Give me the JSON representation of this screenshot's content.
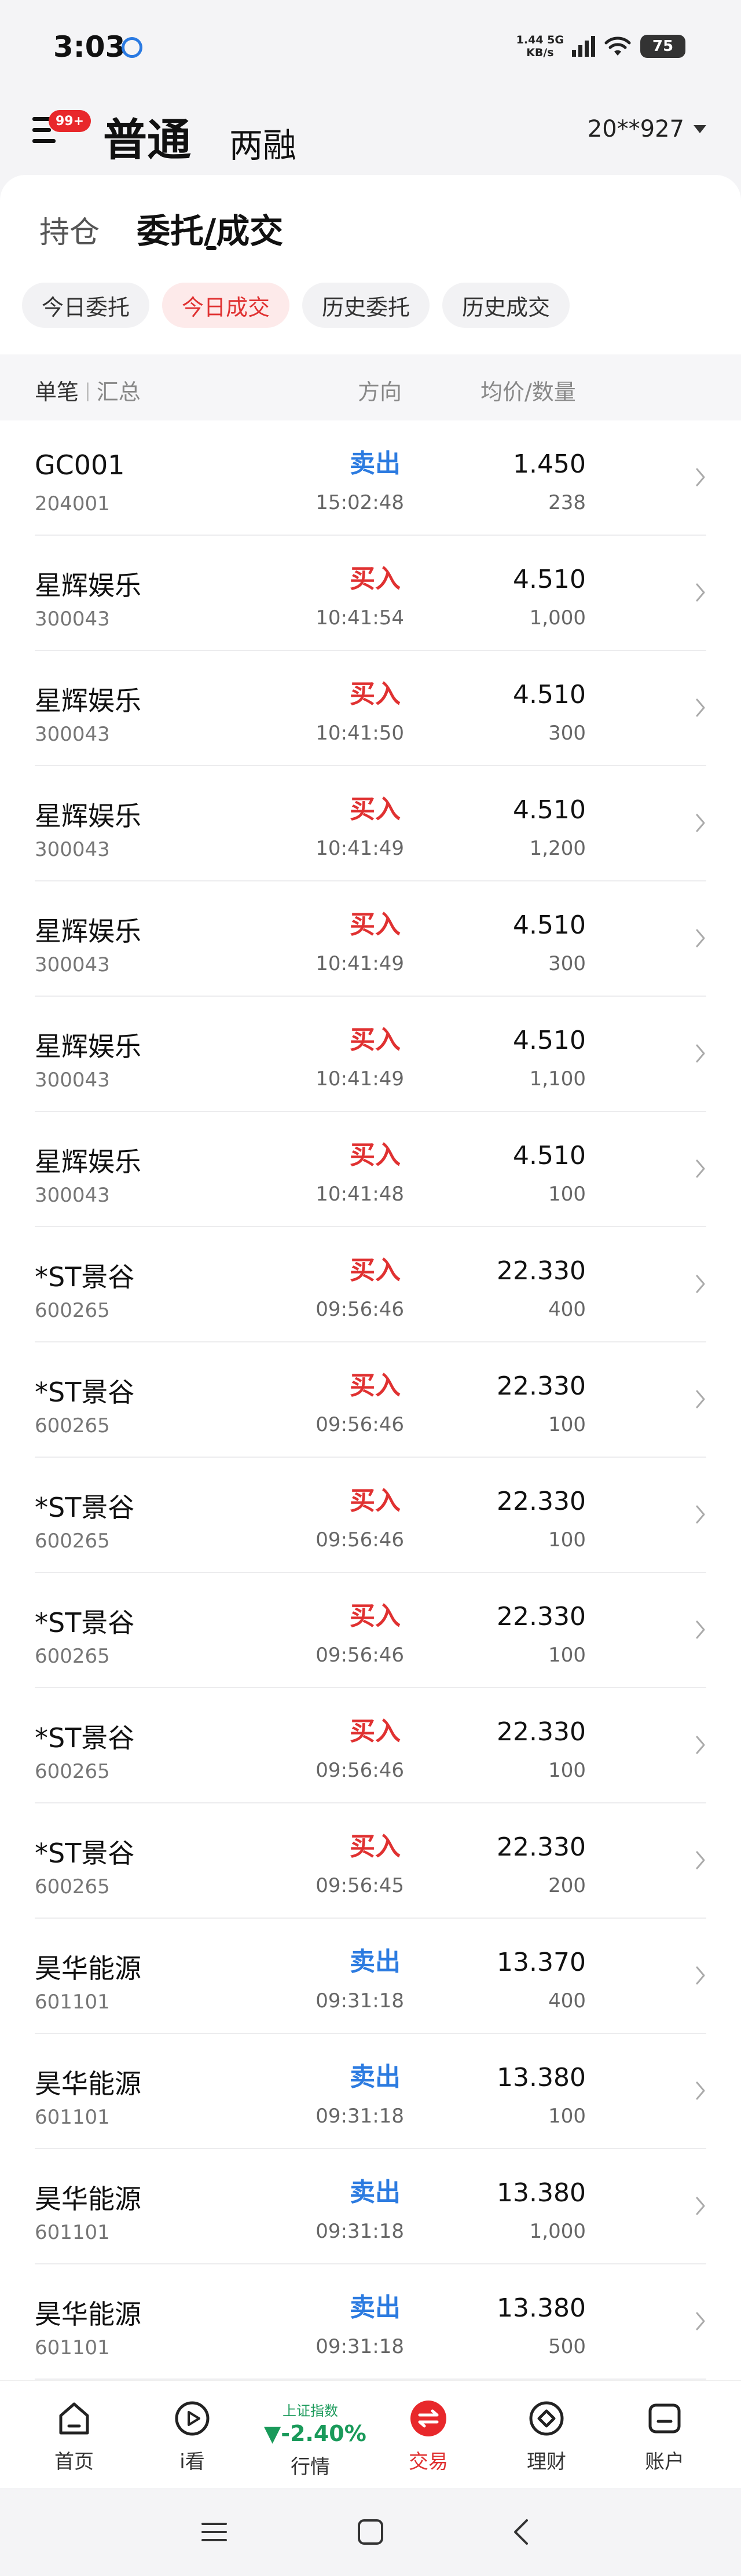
{
  "status_bar": {
    "time": "3:03",
    "net_speed_value": "1.44",
    "net_speed_unit": "KB/s",
    "network": "5G",
    "battery": "75"
  },
  "header": {
    "badge": "99+",
    "mode_main": "普通",
    "mode_sub": "两融",
    "account": "20**927"
  },
  "top_tabs": [
    "持仓",
    "委托/成交"
  ],
  "sub_tabs": [
    "今日委托",
    "今日成交",
    "历史委托",
    "历史成交"
  ],
  "columns": {
    "detail": "单笔",
    "summary": "汇总",
    "direction": "方向",
    "price_qty": "均价/数量"
  },
  "trades": [
    {
      "name": "GC001",
      "code": "204001",
      "side": "卖出",
      "type": "sell",
      "time": "15:02:48",
      "price": "1.450",
      "qty": "238"
    },
    {
      "name": "星辉娱乐",
      "code": "300043",
      "side": "买入",
      "type": "buy",
      "time": "10:41:54",
      "price": "4.510",
      "qty": "1,000"
    },
    {
      "name": "星辉娱乐",
      "code": "300043",
      "side": "买入",
      "type": "buy",
      "time": "10:41:50",
      "price": "4.510",
      "qty": "300"
    },
    {
      "name": "星辉娱乐",
      "code": "300043",
      "side": "买入",
      "type": "buy",
      "time": "10:41:49",
      "price": "4.510",
      "qty": "1,200"
    },
    {
      "name": "星辉娱乐",
      "code": "300043",
      "side": "买入",
      "type": "buy",
      "time": "10:41:49",
      "price": "4.510",
      "qty": "300"
    },
    {
      "name": "星辉娱乐",
      "code": "300043",
      "side": "买入",
      "type": "buy",
      "time": "10:41:49",
      "price": "4.510",
      "qty": "1,100"
    },
    {
      "name": "星辉娱乐",
      "code": "300043",
      "side": "买入",
      "type": "buy",
      "time": "10:41:48",
      "price": "4.510",
      "qty": "100"
    },
    {
      "name": "*ST景谷",
      "code": "600265",
      "side": "买入",
      "type": "buy",
      "time": "09:56:46",
      "price": "22.330",
      "qty": "400"
    },
    {
      "name": "*ST景谷",
      "code": "600265",
      "side": "买入",
      "type": "buy",
      "time": "09:56:46",
      "price": "22.330",
      "qty": "100"
    },
    {
      "name": "*ST景谷",
      "code": "600265",
      "side": "买入",
      "type": "buy",
      "time": "09:56:46",
      "price": "22.330",
      "qty": "100"
    },
    {
      "name": "*ST景谷",
      "code": "600265",
      "side": "买入",
      "type": "buy",
      "time": "09:56:46",
      "price": "22.330",
      "qty": "100"
    },
    {
      "name": "*ST景谷",
      "code": "600265",
      "side": "买入",
      "type": "buy",
      "time": "09:56:46",
      "price": "22.330",
      "qty": "100"
    },
    {
      "name": "*ST景谷",
      "code": "600265",
      "side": "买入",
      "type": "buy",
      "time": "09:56:45",
      "price": "22.330",
      "qty": "200"
    },
    {
      "name": "昊华能源",
      "code": "601101",
      "side": "卖出",
      "type": "sell",
      "time": "09:31:18",
      "price": "13.370",
      "qty": "400"
    },
    {
      "name": "昊华能源",
      "code": "601101",
      "side": "卖出",
      "type": "sell",
      "time": "09:31:18",
      "price": "13.380",
      "qty": "100"
    },
    {
      "name": "昊华能源",
      "code": "601101",
      "side": "卖出",
      "type": "sell",
      "time": "09:31:18",
      "price": "13.380",
      "qty": "1,000"
    },
    {
      "name": "昊华能源",
      "code": "601101",
      "side": "卖出",
      "type": "sell",
      "time": "09:31:18",
      "price": "13.380",
      "qty": "500"
    }
  ],
  "bottom_nav": {
    "home": "首页",
    "watch": "i看",
    "index_name": "上证指数",
    "index_value": "▼-2.40%",
    "market": "行情",
    "trade": "交易",
    "wealth": "理财",
    "account": "账户"
  },
  "colors": {
    "buy": "#e03131",
    "sell": "#2c7be0",
    "index_down": "#1a9a5a",
    "accent": "#e03131"
  }
}
